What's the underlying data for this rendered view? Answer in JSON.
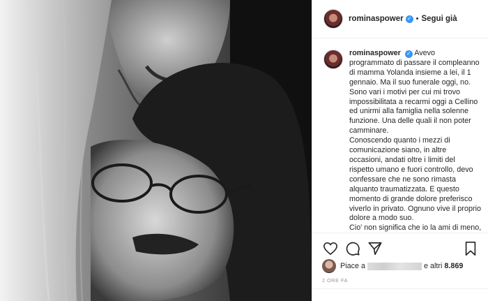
{
  "header": {
    "username": "rominaspower",
    "separator": "•",
    "follow_label": "Segui già"
  },
  "caption": {
    "username": "rominaspower",
    "paragraphs": [
      "Avevo programmato di passare il compleanno di mamma Yolanda insieme a lei, il 1 gennaio. Ma il suo funerale oggi, no. Sono vari i motivi per cui mi trovo impossibilitata a recarmi oggi a Cellino ed unirmi alla famiglia nella solenne funzione. Una delle quali il non poter camminare.",
      "Conoscendo quanto i mezzi di comunicazione siano, in altre occasioni, andati oltre i limiti del rispetto umano e fuori controllo, devo confessare che ne sono rimasta alquanto traumatizzata. E questo momento di grande dolore preferisco viverlo in privato. Ognuno vive il proprio dolore a modo suo.",
      "Cio' non significa che io la ami di meno, essendo lei una delle persone"
    ]
  },
  "likes": {
    "prefix": "Piace a",
    "suffix": "e altri",
    "count": "8.869"
  },
  "timestamp": "2 ORE FA",
  "colors": {
    "verified": "#3897f0",
    "text": "#262626",
    "muted": "#999999",
    "border": "#efefef"
  },
  "icons": [
    "heart-icon",
    "comment-icon",
    "share-icon",
    "bookmark-icon",
    "verified-badge-icon"
  ]
}
